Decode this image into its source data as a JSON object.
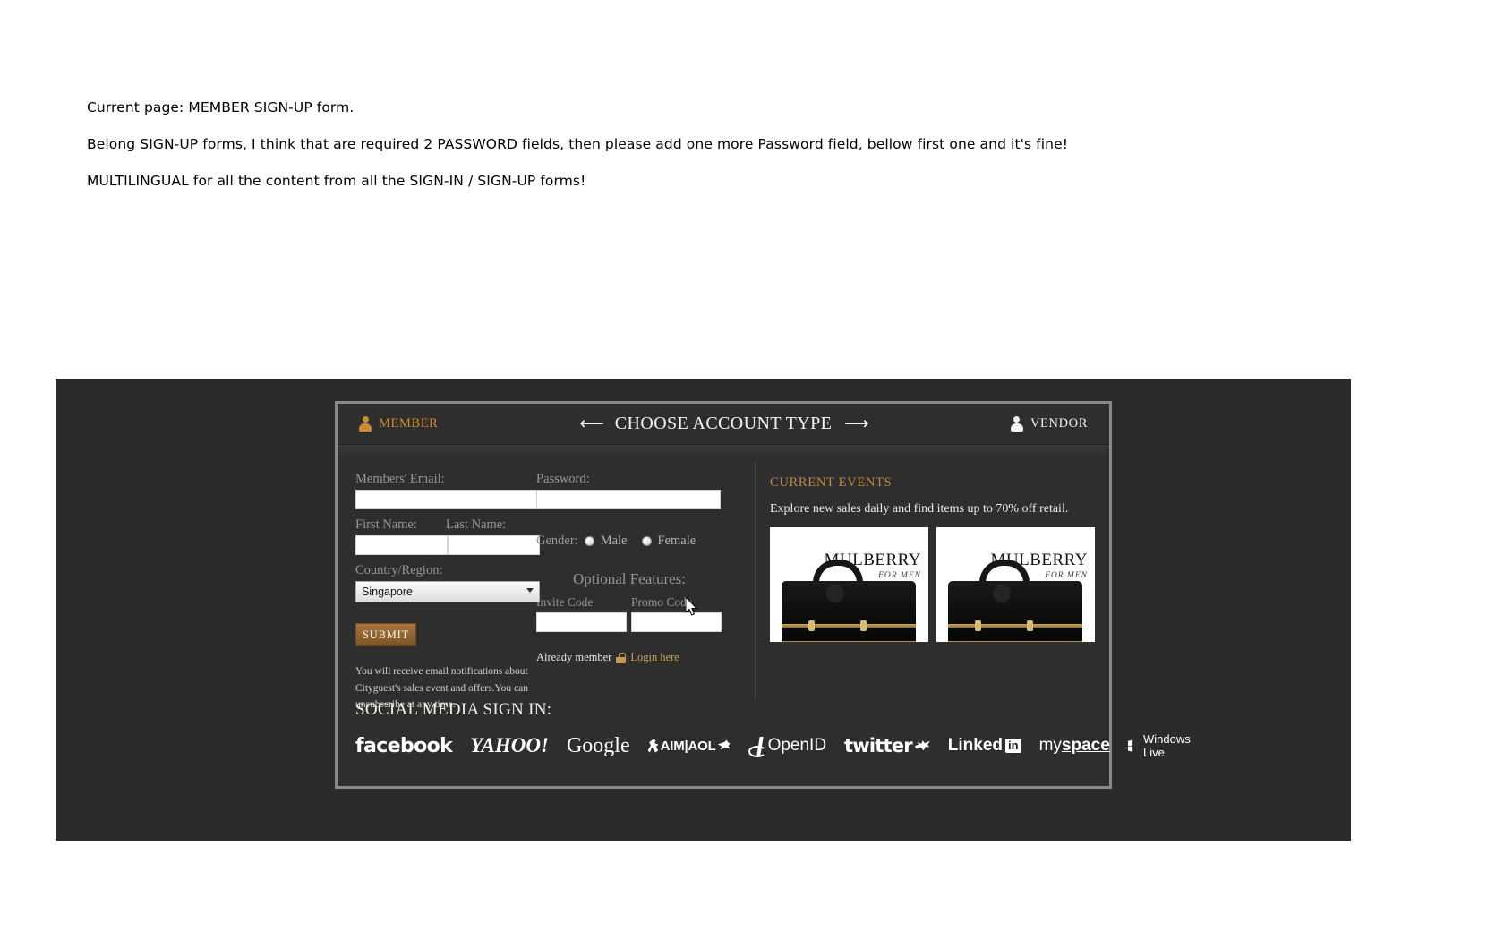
{
  "notes": [
    "Current page: MEMBER SIGN-UP form.",
    "Belong SIGN-UP forms, I think that are required 2 PASSWORD fields, then please add one more Password field, bellow first one and it's fine!",
    "MULTILINGUAL for all the content from all the SIGN-IN / SIGN-UP forms!"
  ],
  "panel": {
    "header": {
      "member_label": "MEMBER",
      "member_icon": "person-icon",
      "vendor_label": "VENDOR",
      "vendor_icon": "person-icon",
      "title": "CHOOSE ACCOUNT TYPE",
      "arrow_left": "⟵",
      "arrow_right": "⟶"
    },
    "form": {
      "email_label": "Members' Email:",
      "email_value": "",
      "first_name_label": "First Name:",
      "first_name_value": "",
      "last_name_label": "Last Name:",
      "last_name_value": "",
      "country_label": "Country/Region:",
      "country_value": "Singapore",
      "country_options": [
        "Singapore"
      ],
      "submit_label": "SUBMIT",
      "disclaimer": "You will receive email notifications about Cityguest's sales event and offers.You can unsubscribe at any time.",
      "password_label": "Password:",
      "password_value": "",
      "gender_label": "Gender:",
      "gender_male": "Male",
      "gender_female": "Female",
      "optional_title": "Optional Features:",
      "invite_code_label": "Invite Code",
      "invite_code_value": "",
      "promo_code_label": "Promo Code",
      "promo_code_value": "",
      "already_member_text": "Already member",
      "lock_icon": "lock-icon",
      "login_link": "Login here"
    },
    "events": {
      "title": "CURRENT EVENTS",
      "subtitle": "Explore new sales daily and find items up to 70% off retail.",
      "thumbs": [
        {
          "brand": "MULBERRY",
          "sub": "FOR MEN"
        },
        {
          "brand": "MULBERRY",
          "sub": "FOR MEN"
        }
      ]
    },
    "social": {
      "title": "SOCIAL MEDIA SIGN IN:",
      "items": [
        {
          "name": "facebook-logo",
          "label": "facebook"
        },
        {
          "name": "yahoo-logo",
          "label": "YAHOO!"
        },
        {
          "name": "google-logo",
          "label": "Google"
        },
        {
          "name": "aim-aol-logo",
          "label": "AIM|AOL"
        },
        {
          "name": "openid-logo",
          "label": "OpenID"
        },
        {
          "name": "twitter-logo",
          "label": "twitter"
        },
        {
          "name": "linkedin-logo",
          "label": "Linked"
        },
        {
          "name": "linkedin-in-badge",
          "label": "in"
        },
        {
          "name": "myspace-logo-my",
          "label": "my"
        },
        {
          "name": "myspace-logo-space",
          "label": "space"
        },
        {
          "name": "windows-live-logo",
          "label": "Windows Live"
        }
      ]
    }
  },
  "colors": {
    "accent_orange": "#cf8b32",
    "panel_bg": "#2e2e2e",
    "band_bg": "#2b2b2b",
    "submit_brown": "#8e6230",
    "link_gold": "#c4a06a"
  }
}
